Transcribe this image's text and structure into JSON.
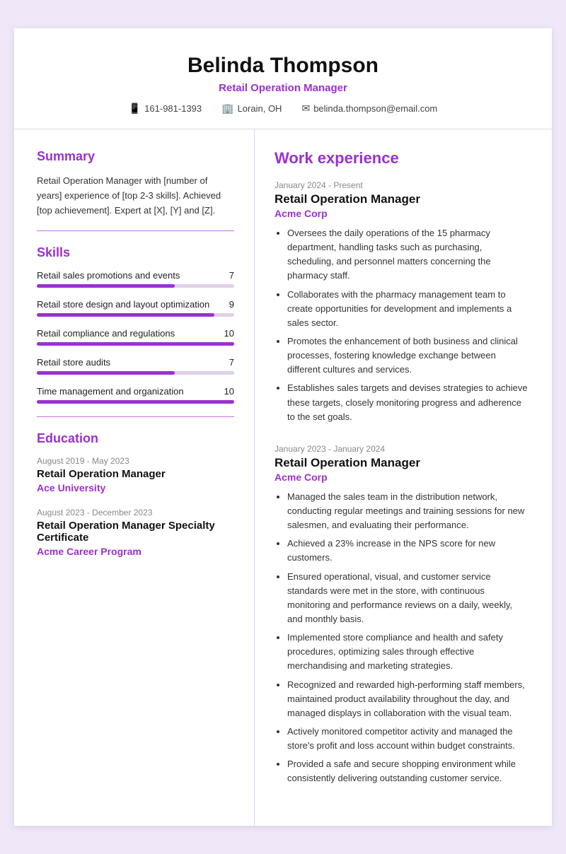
{
  "header": {
    "name": "Belinda Thompson",
    "title": "Retail Operation Manager",
    "phone": "161-981-1393",
    "location": "Lorain, OH",
    "email": "belinda.thompson@email.com",
    "phone_icon": "📱",
    "location_icon": "🏢",
    "email_icon": "✉"
  },
  "summary": {
    "section_title": "Summary",
    "text": "Retail Operation Manager with [number of years] experience of [top 2-3 skills]. Achieved [top achievement]. Expert at [X], [Y] and [Z]."
  },
  "skills": {
    "section_title": "Skills",
    "items": [
      {
        "name": "Retail sales promotions and events",
        "score": 7,
        "percent": 70
      },
      {
        "name": "Retail store design and layout optimization",
        "score": 9,
        "percent": 90
      },
      {
        "name": "Retail compliance and regulations",
        "score": 10,
        "percent": 100
      },
      {
        "name": "Retail store audits",
        "score": 7,
        "percent": 70
      },
      {
        "name": "Time management and organization",
        "score": 10,
        "percent": 100
      }
    ]
  },
  "education": {
    "section_title": "Education",
    "items": [
      {
        "date": "August 2019 - May 2023",
        "degree": "Retail Operation Manager",
        "school": "Ace University"
      },
      {
        "date": "August 2023 - December 2023",
        "degree": "Retail Operation Manager Specialty Certificate",
        "school": "Acme Career Program"
      }
    ]
  },
  "work_experience": {
    "section_title": "Work experience",
    "items": [
      {
        "date": "January 2024 - Present",
        "title": "Retail Operation Manager",
        "company": "Acme Corp",
        "bullets": [
          "Oversees the daily operations of the 15 pharmacy department, handling tasks such as purchasing, scheduling, and personnel matters concerning the pharmacy staff.",
          "Collaborates with the pharmacy management team to create opportunities for development and implements a sales sector.",
          "Promotes the enhancement of both business and clinical processes, fostering knowledge exchange between different cultures and services.",
          "Establishes sales targets and devises strategies to achieve these targets, closely monitoring progress and adherence to the set goals."
        ]
      },
      {
        "date": "January 2023 - January 2024",
        "title": "Retail Operation Manager",
        "company": "Acme Corp",
        "bullets": [
          "Managed the sales team in the distribution network, conducting regular meetings and training sessions for new salesmen, and evaluating their performance.",
          "Achieved a 23% increase in the NPS score for new customers.",
          "Ensured operational, visual, and customer service standards were met in the store, with continuous monitoring and performance reviews on a daily, weekly, and monthly basis.",
          "Implemented store compliance and health and safety procedures, optimizing sales through effective merchandising and marketing strategies.",
          "Recognized and rewarded high-performing staff members, maintained product availability throughout the day, and managed displays in collaboration with the visual team.",
          "Actively monitored competitor activity and managed the store's profit and loss account within budget constraints.",
          "Provided a safe and secure shopping environment while consistently delivering outstanding customer service."
        ]
      }
    ]
  }
}
